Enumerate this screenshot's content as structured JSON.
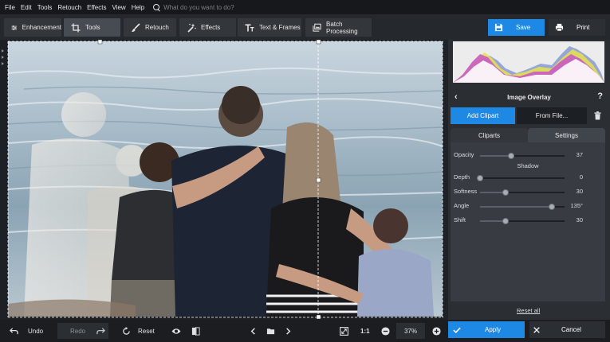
{
  "menu": {
    "items": [
      "File",
      "Edit",
      "Tools",
      "Retouch",
      "Effects",
      "View",
      "Help"
    ],
    "search_placeholder": "What do you want to do?"
  },
  "toolbar": {
    "tabs": [
      {
        "label": "Enhancement",
        "icon": "sliders-icon"
      },
      {
        "label": "Tools",
        "icon": "crop-icon",
        "active": true
      },
      {
        "label": "Retouch",
        "icon": "brush-icon"
      },
      {
        "label": "Effects",
        "icon": "magic-wand-icon"
      },
      {
        "label": "Text & Frames",
        "icon": "text-icon"
      },
      {
        "label": "Batch Processing",
        "icon": "batch-icon"
      }
    ],
    "save_label": "Save",
    "print_label": "Print"
  },
  "panel": {
    "title": "Image Overlay",
    "back_icon": "chevron-left-icon",
    "help_label": "?",
    "add_clipart_label": "Add Clipart",
    "from_file_label": "From File...",
    "subtabs": [
      "Cliparts",
      "Settings"
    ],
    "active_subtab": "Settings",
    "shadow_heading": "Shadow",
    "sliders": [
      {
        "label": "Opacity",
        "value": "37",
        "fraction": 0.37
      },
      {
        "label": "Depth",
        "value": "0",
        "fraction": 0.0
      },
      {
        "label": "Softness",
        "value": "30",
        "fraction": 0.3
      },
      {
        "label": "Angle",
        "value": "135°",
        "fraction": 0.85
      },
      {
        "label": "Shift",
        "value": "30",
        "fraction": 0.3
      }
    ],
    "reset_all_label": "Reset all"
  },
  "bottom": {
    "undo_label": "Undo",
    "redo_label": "Redo",
    "reset_label": "Reset",
    "ratio_label": "1:1",
    "zoom_value": "37%",
    "apply_label": "Apply",
    "cancel_label": "Cancel"
  },
  "colors": {
    "accent": "#1e88e5",
    "panel_bg": "#2b2f34",
    "toolbar_bg": "#25282c"
  }
}
